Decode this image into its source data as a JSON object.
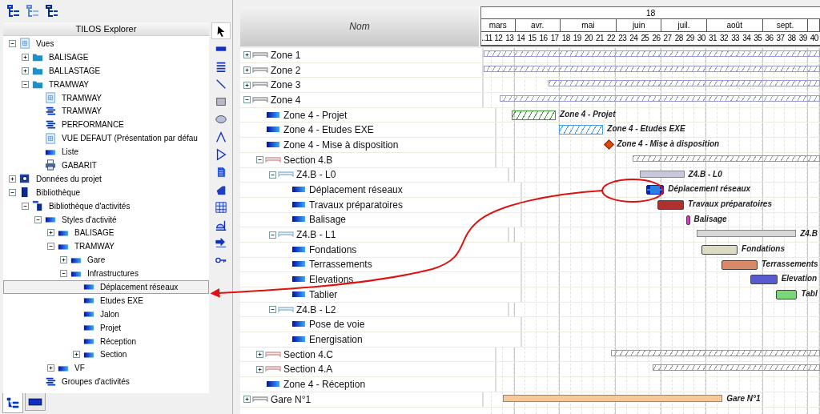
{
  "explorer": {
    "title": "TILOS Explorer",
    "tree": [
      {
        "label": "Vues",
        "kind": "view",
        "expanded": true,
        "selected": false,
        "children": [
          {
            "label": "BALISAGE",
            "kind": "folder",
            "expanded": false,
            "selected": false
          },
          {
            "label": "BALLASTAGE",
            "kind": "folder",
            "expanded": false,
            "selected": false
          },
          {
            "label": "TRAMWAY",
            "kind": "folder",
            "expanded": true,
            "selected": false,
            "children": [
              {
                "label": "TRAMWAY",
                "kind": "view",
                "selected": false
              },
              {
                "label": "TRAMWAY",
                "kind": "list",
                "selected": false
              },
              {
                "label": "PERFORMANCE",
                "kind": "list",
                "selected": false
              },
              {
                "label": "VUE DEFAUT (Présentation par défau",
                "kind": "view",
                "selected": false
              },
              {
                "label": "Liste",
                "kind": "style",
                "selected": false
              },
              {
                "label": "GABARIT",
                "kind": "printer",
                "selected": false
              }
            ]
          }
        ]
      },
      {
        "label": "Données du projet",
        "kind": "data",
        "expanded": false,
        "selected": false
      },
      {
        "label": "Bibliothèque",
        "kind": "book",
        "expanded": true,
        "selected": false,
        "children": [
          {
            "label": "Bibliothèque d'activités",
            "kind": "library",
            "expanded": true,
            "selected": false,
            "children": [
              {
                "label": "Styles d'activité",
                "kind": "style",
                "expanded": true,
                "selected": false,
                "children": [
                  {
                    "label": "BALISAGE",
                    "kind": "style",
                    "expanded": false,
                    "selected": false
                  },
                  {
                    "label": "TRAMWAY",
                    "kind": "style",
                    "expanded": true,
                    "selected": false,
                    "children": [
                      {
                        "label": "Gare",
                        "kind": "style",
                        "expanded": false,
                        "selected": false
                      },
                      {
                        "label": "Infrastructures",
                        "kind": "style",
                        "expanded": true,
                        "selected": false,
                        "children": [
                          {
                            "label": "Déplacement réseaux",
                            "kind": "style",
                            "selected": true
                          },
                          {
                            "label": "Etudes EXE",
                            "kind": "style",
                            "selected": false
                          },
                          {
                            "label": "Jalon",
                            "kind": "style",
                            "selected": false
                          },
                          {
                            "label": "Projet",
                            "kind": "style",
                            "selected": false
                          },
                          {
                            "label": "Réception",
                            "kind": "style",
                            "selected": false
                          },
                          {
                            "label": "Section",
                            "kind": "style",
                            "expanded": false,
                            "selected": false
                          }
                        ]
                      }
                    ]
                  },
                  {
                    "label": "VF",
                    "kind": "style",
                    "expanded": false,
                    "selected": false
                  }
                ]
              },
              {
                "label": "Groupes d'activités",
                "kind": "list",
                "selected": false
              }
            ]
          }
        ]
      }
    ],
    "tools": [
      {
        "kind": "pointer",
        "selected": true
      },
      {
        "kind": "bar",
        "selected": false
      },
      {
        "kind": "lines",
        "selected": false
      },
      {
        "kind": "line",
        "selected": false
      },
      {
        "kind": "rectangle",
        "selected": false
      },
      {
        "kind": "ellipse",
        "selected": false
      },
      {
        "kind": "polyline",
        "selected": false
      },
      {
        "kind": "triangle",
        "selected": false
      },
      {
        "kind": "document",
        "selected": false
      },
      {
        "kind": "shape",
        "selected": false
      },
      {
        "kind": "grid",
        "selected": false
      },
      {
        "kind": "gauge",
        "selected": false
      },
      {
        "kind": "import",
        "selected": false
      },
      {
        "kind": "key",
        "selected": false
      }
    ],
    "tabs": [
      {
        "kind": "tree",
        "selected": true
      },
      {
        "kind": "bar",
        "selected": false
      }
    ]
  },
  "plan": {
    "name_header": "Nom",
    "timeline": {
      "year": "18",
      "months": [
        {
          "label": "mars",
          "weeks": [
            "..11",
            "12",
            "13"
          ]
        },
        {
          "label": "avr.",
          "weeks": [
            "14",
            "15",
            "16",
            "17"
          ]
        },
        {
          "label": "mai",
          "weeks": [
            "18",
            "19",
            "20",
            "21",
            "22"
          ]
        },
        {
          "label": "juin",
          "weeks": [
            "23",
            "24",
            "25",
            "26"
          ]
        },
        {
          "label": "juil.",
          "weeks": [
            "27",
            "28",
            "29",
            "30"
          ]
        },
        {
          "label": "août",
          "weeks": [
            "31",
            "32",
            "33",
            "34",
            "35"
          ]
        },
        {
          "label": "sept.",
          "weeks": [
            "36",
            "37",
            "38",
            "39"
          ]
        },
        {
          "weeks": [
            "40"
          ]
        }
      ]
    },
    "rows": [
      {
        "label": "Zone 1",
        "kind": "zone",
        "expanded": false,
        "bar": {
          "kind": "summary",
          "color": "#9a9ad0",
          "selected": false
        }
      },
      {
        "label": "Zone 2",
        "kind": "zone",
        "expanded": false,
        "bar": {
          "kind": "summary",
          "color": "#9a9ad0",
          "selected": false
        }
      },
      {
        "label": "Zone 3",
        "kind": "zone",
        "expanded": false,
        "bar": {
          "kind": "summary",
          "color": "#9a9ad0",
          "selected": false
        }
      },
      {
        "label": "Zone 4",
        "kind": "zone",
        "expanded": true,
        "bar": {
          "kind": "summary",
          "color": "#9a9ad0",
          "selected": false
        },
        "children": [
          {
            "label": "Zone 4 - Projet",
            "kind": "task",
            "bar": {
              "kind": "outline",
              "color": "#3a9a3a",
              "selected": false,
              "label": "Zone 4 - Projet"
            }
          },
          {
            "label": "Zone 4 - Etudes EXE",
            "kind": "task",
            "bar": {
              "kind": "outline",
              "color": "#4aa0e8",
              "selected": false,
              "label": "Zone 4 - Etudes EXE"
            }
          },
          {
            "label": "Zone 4 - Mise à disposition",
            "kind": "task",
            "bar": {
              "kind": "milestone",
              "color": "#d84a10",
              "selected": false,
              "label": "Zone 4 - Mise à disposition"
            }
          },
          {
            "label": "Section 4.B",
            "kind": "section",
            "expanded": true,
            "bar": {
              "kind": "summary",
              "color": "#999999",
              "selected": false
            },
            "children": [
              {
                "label": "Z4.B - L0",
                "kind": "phase",
                "expanded": true,
                "bar": {
                  "kind": "group",
                  "color": "#c8c8dc",
                  "selected": false,
                  "label": "Z4.B - L0"
                },
                "children": [
                  {
                    "label": "Déplacement réseaux",
                    "kind": "task",
                    "bar": {
                      "kind": "task",
                      "color": "#2a80e0",
                      "selected": true,
                      "label": "Déplacement réseaux"
                    }
                  },
                  {
                    "label": "Travaux préparatoires",
                    "kind": "task",
                    "bar": {
                      "kind": "task",
                      "color": "#b03030",
                      "selected": false,
                      "label": "Travaux préparatoires"
                    }
                  },
                  {
                    "label": "Balisage",
                    "kind": "task",
                    "bar": {
                      "kind": "task",
                      "color": "#d040c0",
                      "selected": false,
                      "label": "Balisage"
                    }
                  }
                ]
              },
              {
                "label": "Z4.B - L1",
                "kind": "phase",
                "expanded": true,
                "bar": {
                  "kind": "group",
                  "color": "#d8d8d8",
                  "selected": false,
                  "label": "Z4.B"
                },
                "children": [
                  {
                    "label": "Fondations",
                    "kind": "task",
                    "bar": {
                      "kind": "task",
                      "color": "#dcdcc4",
                      "selected": false,
                      "label": "Fondations"
                    }
                  },
                  {
                    "label": "Terrassements",
                    "kind": "task",
                    "bar": {
                      "kind": "task",
                      "color": "#d88a68",
                      "selected": false,
                      "label": "Terrassements"
                    }
                  },
                  {
                    "label": "Elevations",
                    "kind": "task",
                    "bar": {
                      "kind": "task",
                      "color": "#5a5ad0",
                      "selected": false,
                      "label": "Elevation"
                    }
                  },
                  {
                    "label": "Tablier",
                    "kind": "task",
                    "bar": {
                      "kind": "task",
                      "color": "#78d878",
                      "selected": false,
                      "label": "Tabl"
                    }
                  }
                ]
              },
              {
                "label": "Z4.B - L2",
                "kind": "phase",
                "expanded": true,
                "children": [
                  {
                    "label": "Pose de voie",
                    "kind": "task"
                  },
                  {
                    "label": "Energisation",
                    "kind": "task"
                  }
                ]
              }
            ]
          },
          {
            "label": "Section 4.C",
            "kind": "section",
            "expanded": false,
            "bar": {
              "kind": "summary",
              "color": "#999999",
              "selected": false
            }
          },
          {
            "label": "Section 4.A",
            "kind": "section",
            "expanded": false,
            "bar": {
              "kind": "summary",
              "color": "#999999",
              "selected": false
            }
          },
          {
            "label": "Zone 4 - Réception",
            "kind": "task"
          }
        ]
      },
      {
        "label": "Gare N°1",
        "kind": "zone",
        "expanded": false,
        "bar": {
          "kind": "group",
          "color": "#f8c898",
          "selected": false,
          "label": "Gare N°1"
        }
      }
    ]
  }
}
